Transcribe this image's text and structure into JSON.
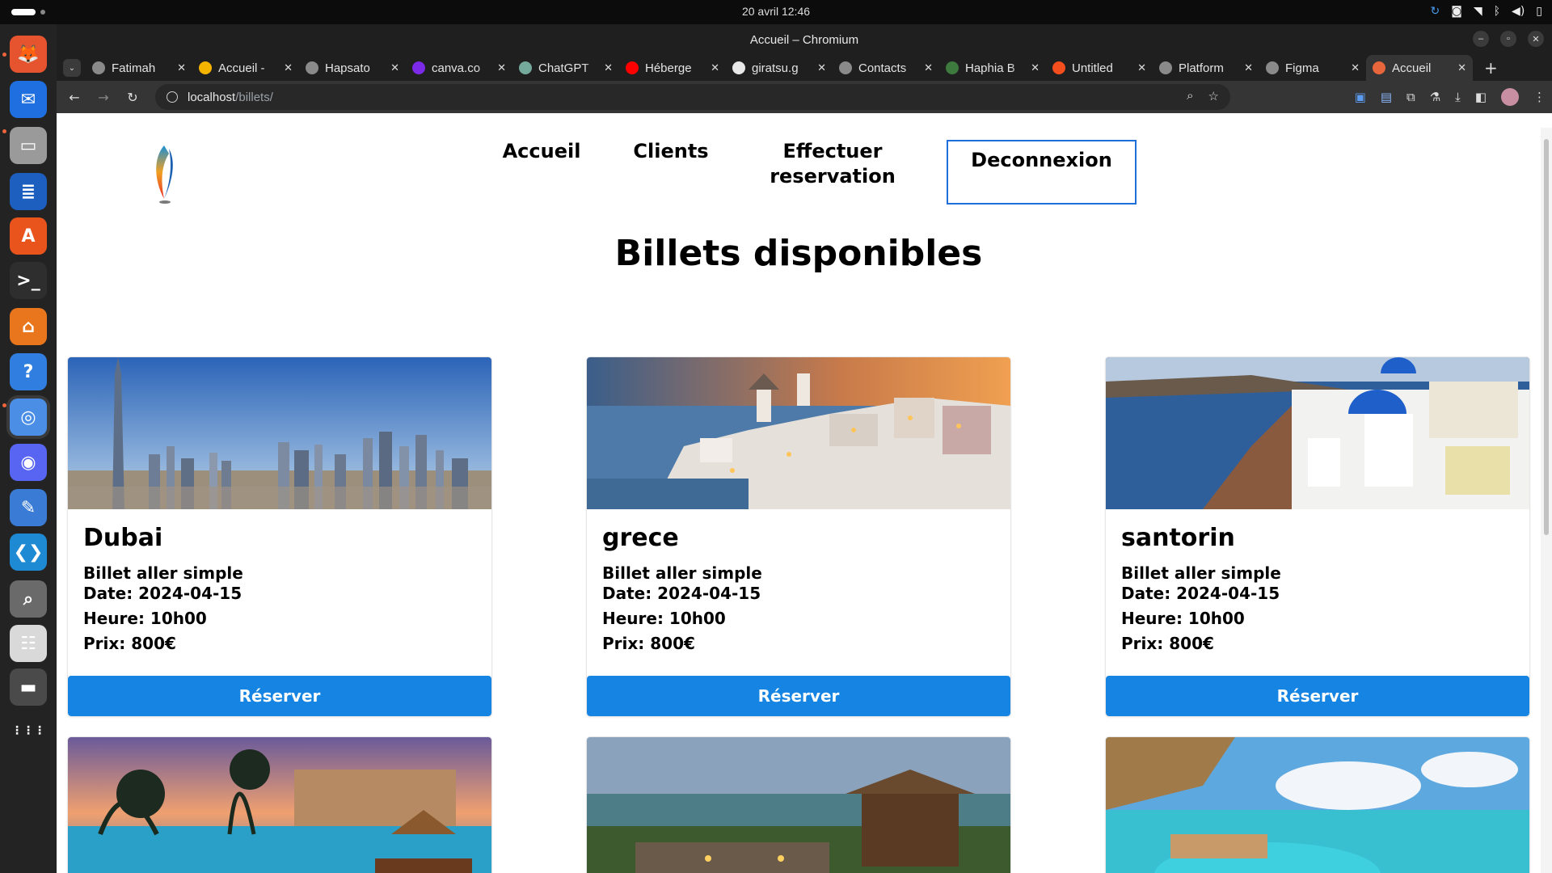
{
  "system": {
    "clock": "20 avril  12:46",
    "tray_icons": [
      "refresh-icon",
      "discord-icon",
      "wifi-icon",
      "bluetooth-icon",
      "volume-icon",
      "battery-icon"
    ]
  },
  "dock": {
    "items": [
      {
        "name": "firefox",
        "color": "#e5542f",
        "glyph": "🦊"
      },
      {
        "name": "thunderbird",
        "color": "#1f6fe0",
        "glyph": "✉"
      },
      {
        "name": "files",
        "color": "#9a9a9a",
        "glyph": "▭"
      },
      {
        "name": "writer",
        "color": "#1d5fbf",
        "glyph": "≣"
      },
      {
        "name": "app-center",
        "color": "#e9541c",
        "glyph": "A"
      },
      {
        "name": "terminal",
        "color": "#2e2e2e",
        "glyph": ">_"
      },
      {
        "name": "package-manager",
        "color": "#e9761c",
        "glyph": "⌂"
      },
      {
        "name": "help",
        "color": "#2f7ee0",
        "glyph": "?"
      },
      {
        "name": "chromium",
        "color": "#4a8ee6",
        "glyph": "◎"
      },
      {
        "name": "discord",
        "color": "#5865f2",
        "glyph": "◉"
      },
      {
        "name": "text-editor",
        "color": "#3a7bd5",
        "glyph": "✎"
      },
      {
        "name": "vscode",
        "color": "#1f8ad4",
        "glyph": "❮❯"
      },
      {
        "name": "search",
        "color": "#6a6a6a",
        "glyph": "⌕"
      },
      {
        "name": "document-viewer",
        "color": "#d9d9d9",
        "glyph": "☷"
      },
      {
        "name": "removable",
        "color": "#4a4a4a",
        "glyph": "▬"
      },
      {
        "name": "app-grid",
        "color": "#232323",
        "glyph": "⋮⋮⋮"
      }
    ]
  },
  "browser": {
    "window_title": "Accueil – Chromium",
    "tabs": [
      {
        "label": "Fatimah",
        "icon": "globe-icon",
        "color": "#8a8a8a"
      },
      {
        "label": "Accueil -",
        "icon": "drive-icon",
        "color": "#f4b400"
      },
      {
        "label": "Hapsato",
        "icon": "globe-icon",
        "color": "#8a8a8a"
      },
      {
        "label": "canva.co",
        "icon": "canva-icon",
        "color": "#7d2ae8"
      },
      {
        "label": "ChatGPT",
        "icon": "chatgpt-icon",
        "color": "#74aa9c"
      },
      {
        "label": "Héberge",
        "icon": "youtube-icon",
        "color": "#ff0000"
      },
      {
        "label": "giratsu.g",
        "icon": "github-icon",
        "color": "#e8e8e8"
      },
      {
        "label": "Contacts",
        "icon": "globe-icon",
        "color": "#8a8a8a"
      },
      {
        "label": "Haphia B",
        "icon": "haphia-icon",
        "color": "#3d7a3d"
      },
      {
        "label": "Untitled",
        "icon": "figma-icon",
        "color": "#f24e1e"
      },
      {
        "label": "Platform",
        "icon": "globe-icon",
        "color": "#8a8a8a"
      },
      {
        "label": "Figma",
        "icon": "globe-icon",
        "color": "#8a8a8a"
      },
      {
        "label": "Accueil",
        "icon": "site-icon",
        "color": "#e8663c",
        "active": true
      }
    ],
    "url_host": "localhost",
    "url_path": "/billets/"
  },
  "site": {
    "nav": {
      "accueil": "Accueil",
      "clients": "Clients",
      "reservation_line1": "Effectuer",
      "reservation_line2": "reservation",
      "deconnexion": "Deconnexion"
    },
    "title": "Billets disponibles",
    "cards": [
      {
        "destination": "Dubai",
        "type": "Billet aller simple",
        "date": "Date: 2024-04-15",
        "heure": "Heure: 10h00",
        "prix": "Prix: 800€",
        "button": "Réserver",
        "image": "dubai-skyline"
      },
      {
        "destination": "grece",
        "type": "Billet aller simple",
        "date": "Date: 2024-04-15",
        "heure": "Heure: 10h00",
        "prix": "Prix: 800€",
        "button": "Réserver",
        "image": "oia-village-dusk"
      },
      {
        "destination": "santorin",
        "type": "Billet aller simple",
        "date": "Date: 2024-04-15",
        "heure": "Heure: 10h00",
        "prix": "Prix: 800€",
        "button": "Réserver",
        "image": "santorini-blue-domes"
      }
    ],
    "second_row_images": [
      "tropical-resort-pool",
      "beach-restaurant",
      "overwater-infinity-pool"
    ],
    "colors": {
      "button": "#1584e2",
      "nav_border": "#1e6fd9"
    }
  }
}
